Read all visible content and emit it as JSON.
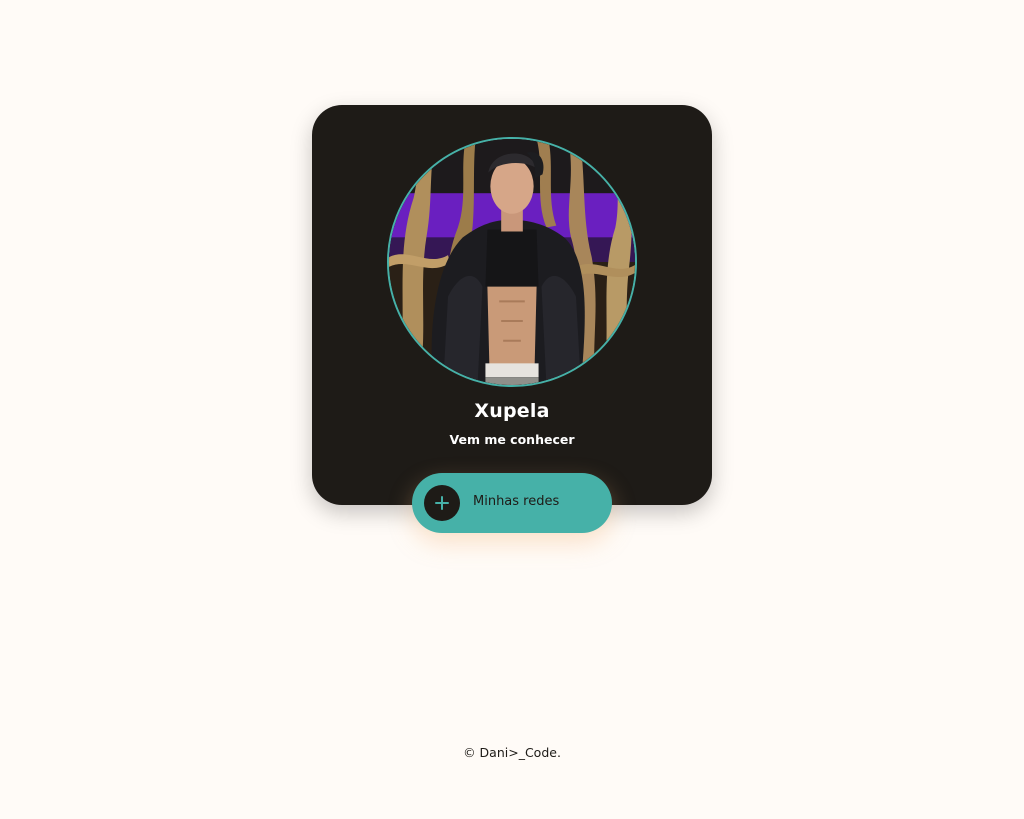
{
  "profile": {
    "name": "Xupela",
    "subtitle": "Vem me conhecer"
  },
  "networks_button": {
    "label": "Minhas redes",
    "icon": "plus-icon"
  },
  "footer": {
    "text": "© Dani>_Code."
  },
  "colors": {
    "background": "#fffbf7",
    "card": "#1e1b17",
    "accent": "#46b1a8",
    "text_light": "#ffffff",
    "text_dark": "#1e1b17"
  }
}
